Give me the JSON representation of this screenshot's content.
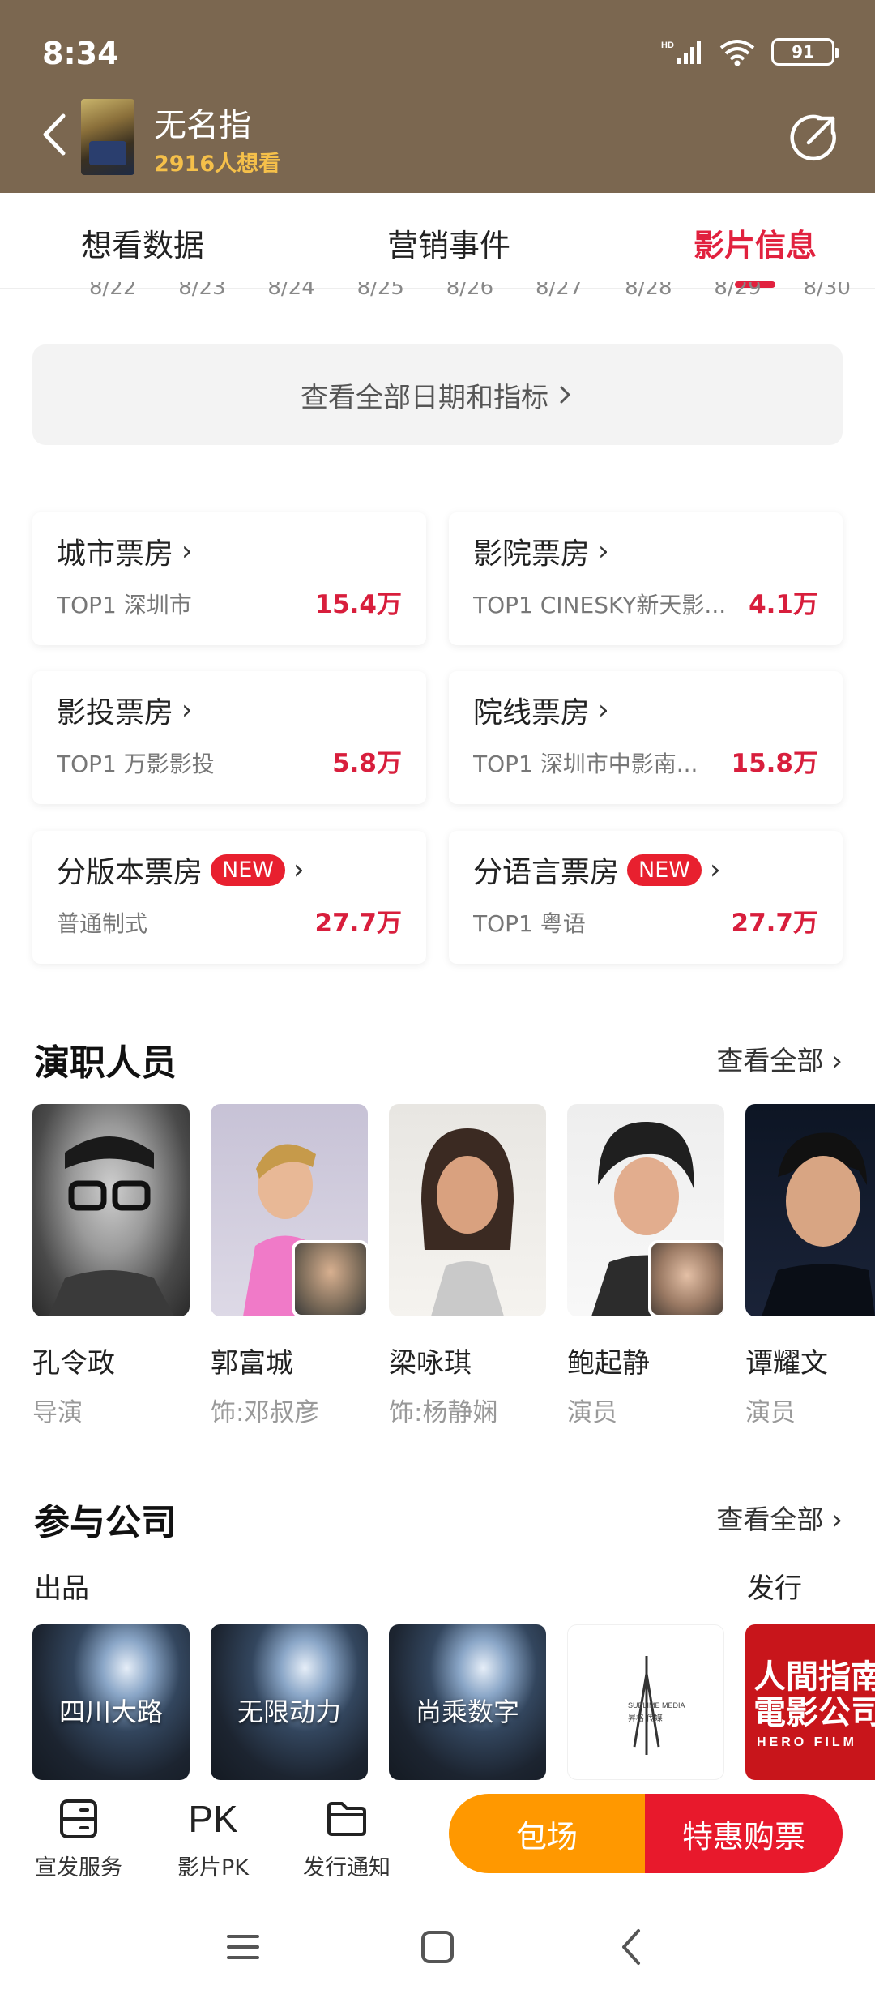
{
  "status_bar": {
    "time": "8:34",
    "battery": "91"
  },
  "header": {
    "title": "无名指",
    "want_count": "2916人想看"
  },
  "tabs": [
    {
      "label": "想看数据"
    },
    {
      "label": "营销事件"
    },
    {
      "label": "影片信息"
    }
  ],
  "date_axis": [
    "8/22",
    "8/23",
    "8/24",
    "8/25",
    "8/26",
    "8/27",
    "8/28",
    "8/29",
    "8/30"
  ],
  "all_dates_link": "查看全部日期和指标",
  "box_office": [
    {
      "title": "城市票房",
      "sub": "TOP1 深圳市",
      "value": "15.4万"
    },
    {
      "title": "影院票房",
      "sub": "TOP1 CINESKY新天影...",
      "value": "4.1万"
    },
    {
      "title": "影投票房",
      "sub": "TOP1 万影影投",
      "value": "5.8万"
    },
    {
      "title": "院线票房",
      "sub": "TOP1 深圳市中影南...",
      "value": "15.8万"
    },
    {
      "title": "分版本票房",
      "badge": "NEW",
      "sub": "普通制式",
      "value": "27.7万"
    },
    {
      "title": "分语言票房",
      "badge": "NEW",
      "sub": "TOP1 粤语",
      "value": "27.7万"
    }
  ],
  "cast_section": {
    "title": "演职人员",
    "see_all": "查看全部",
    "people": [
      {
        "name": "孔令政",
        "role": "导演"
      },
      {
        "name": "郭富城",
        "role": "饰:邓叔彦"
      },
      {
        "name": "梁咏琪",
        "role": "饰:杨静娴"
      },
      {
        "name": "鲍起静",
        "role": "演员"
      },
      {
        "name": "谭耀文",
        "role": "演员"
      }
    ]
  },
  "company_section": {
    "title": "参与公司",
    "see_all": "查看全部",
    "produce_label": "出品",
    "distribute_label": "发行",
    "companies": [
      {
        "name": "四川大路"
      },
      {
        "name": "无限动力"
      },
      {
        "name": "尚乘数字"
      }
    ],
    "logo_sublime": {
      "line1": "SUBLIME MEDIA",
      "line2": "昇格 传媒"
    },
    "logo_hero": {
      "line1": "人間指南",
      "line2": "電影公司",
      "line3": "HERO FILM"
    }
  },
  "bottom_bar": {
    "items": [
      {
        "label": "宣发服务"
      },
      {
        "label": "影片PK",
        "icon_text": "PK"
      },
      {
        "label": "发行通知"
      }
    ],
    "btn_pack": "包场",
    "btn_buy": "特惠购票"
  },
  "colors": {
    "accent": "#e1213e",
    "header_bg": "#7b6750",
    "orange": "#ff9800"
  }
}
